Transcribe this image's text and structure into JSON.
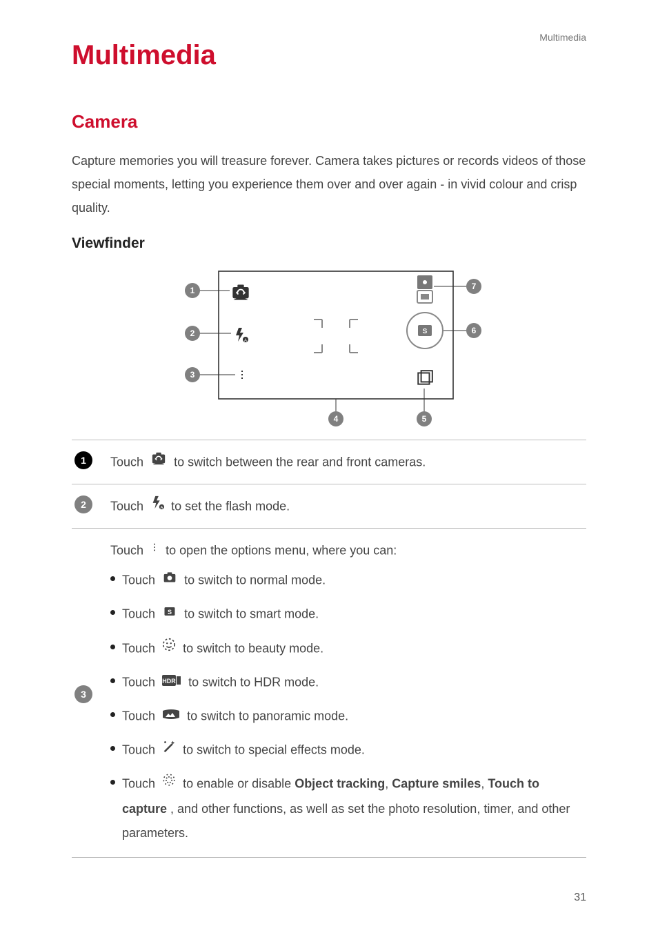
{
  "header": {
    "breadcrumb": "Multimedia"
  },
  "title": "Multimedia",
  "section": {
    "title": "Camera"
  },
  "intro": "Capture memories you will treasure forever. Camera takes pictures or records videos of those special moments, letting you experience them over and over again - in vivid colour and crisp quality.",
  "subsection": "Viewfinder",
  "diagram": {
    "callouts": [
      "1",
      "2",
      "3",
      "4",
      "5",
      "6",
      "7"
    ]
  },
  "rows": {
    "r1": {
      "pre": "Touch ",
      "post": "to switch between the rear and front cameras."
    },
    "r2": {
      "pre": "Touch ",
      "post": "to set the flash mode."
    },
    "r3": {
      "lead_pre": "Touch ",
      "lead_post": " to open the options menu, where you can:",
      "b_touch": "Touch ",
      "b1": "to switch to normal mode.",
      "b2": "to switch to smart mode.",
      "b3": "to switch to beauty mode.",
      "b4": "to switch to HDR mode.",
      "b5": "to switch to panoramic mode.",
      "b6": "to switch to special effects mode.",
      "b7_pre": " to enable or disable ",
      "b7_b1": "Object tracking",
      "b7_s1": ", ",
      "b7_b2": "Capture smiles",
      "b7_s2": ", ",
      "b7_b3": "Touch to capture",
      "b7_post": ", and other functions, as well as set the photo resolution, timer, and other parameters."
    }
  },
  "page_number": "31",
  "icons": {
    "switch_camera": "switch-camera-icon",
    "flash": "flash-icon",
    "menu_dots": "menu-dots-icon",
    "normal": "normal-camera-icon",
    "smart": "smart-s-icon",
    "beauty": "beauty-face-icon",
    "hdr": "hdr-icon",
    "panoramic": "panoramic-icon",
    "effects": "special-effects-icon",
    "gear": "gear-icon",
    "shutter": "shutter-button-icon",
    "gallery": "gallery-thumbnail-icon",
    "mode_tab_photo": "photo-tab-icon",
    "mode_tab_video": "video-tab-icon"
  }
}
